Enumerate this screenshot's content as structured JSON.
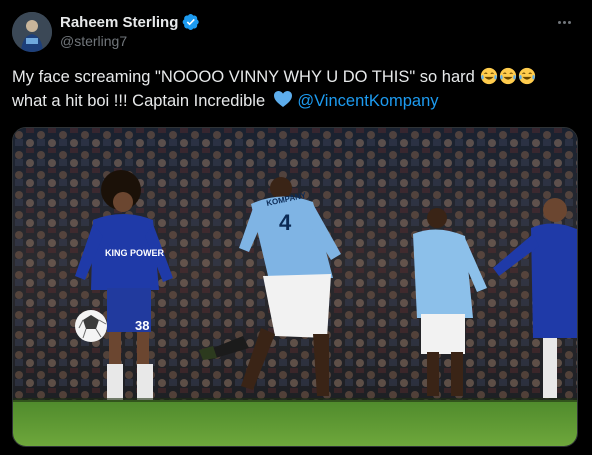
{
  "author": {
    "display_name": "Raheem Sterling",
    "handle": "@sterling7",
    "verified": true,
    "avatar_icon": "profile-photo"
  },
  "tweet": {
    "text_line1": "My face screaming \"NOOOO VINNY WHY U DO THIS\" so hard",
    "text_line2": "what a hit boi !!! Captain Incredible",
    "emojis_line1": [
      "face-with-tears-of-joy",
      "face-with-tears-of-joy",
      "face-with-tears-of-joy"
    ],
    "heart_emoji": "blue-heart",
    "mention": "@VincentKompany"
  },
  "media": {
    "description_icon": "football-photo",
    "jersey_center": "4",
    "jersey_center_name": "KOMPANY",
    "jersey_left_number": "38",
    "jersey_left_sponsor": "KING POWER"
  },
  "colors": {
    "background": "#000000",
    "text": "#e7e9ea",
    "secondary": "#71767b",
    "link": "#1d9bf0",
    "verified": "#1d9bf0"
  },
  "more_icon": "ellipsis-icon"
}
